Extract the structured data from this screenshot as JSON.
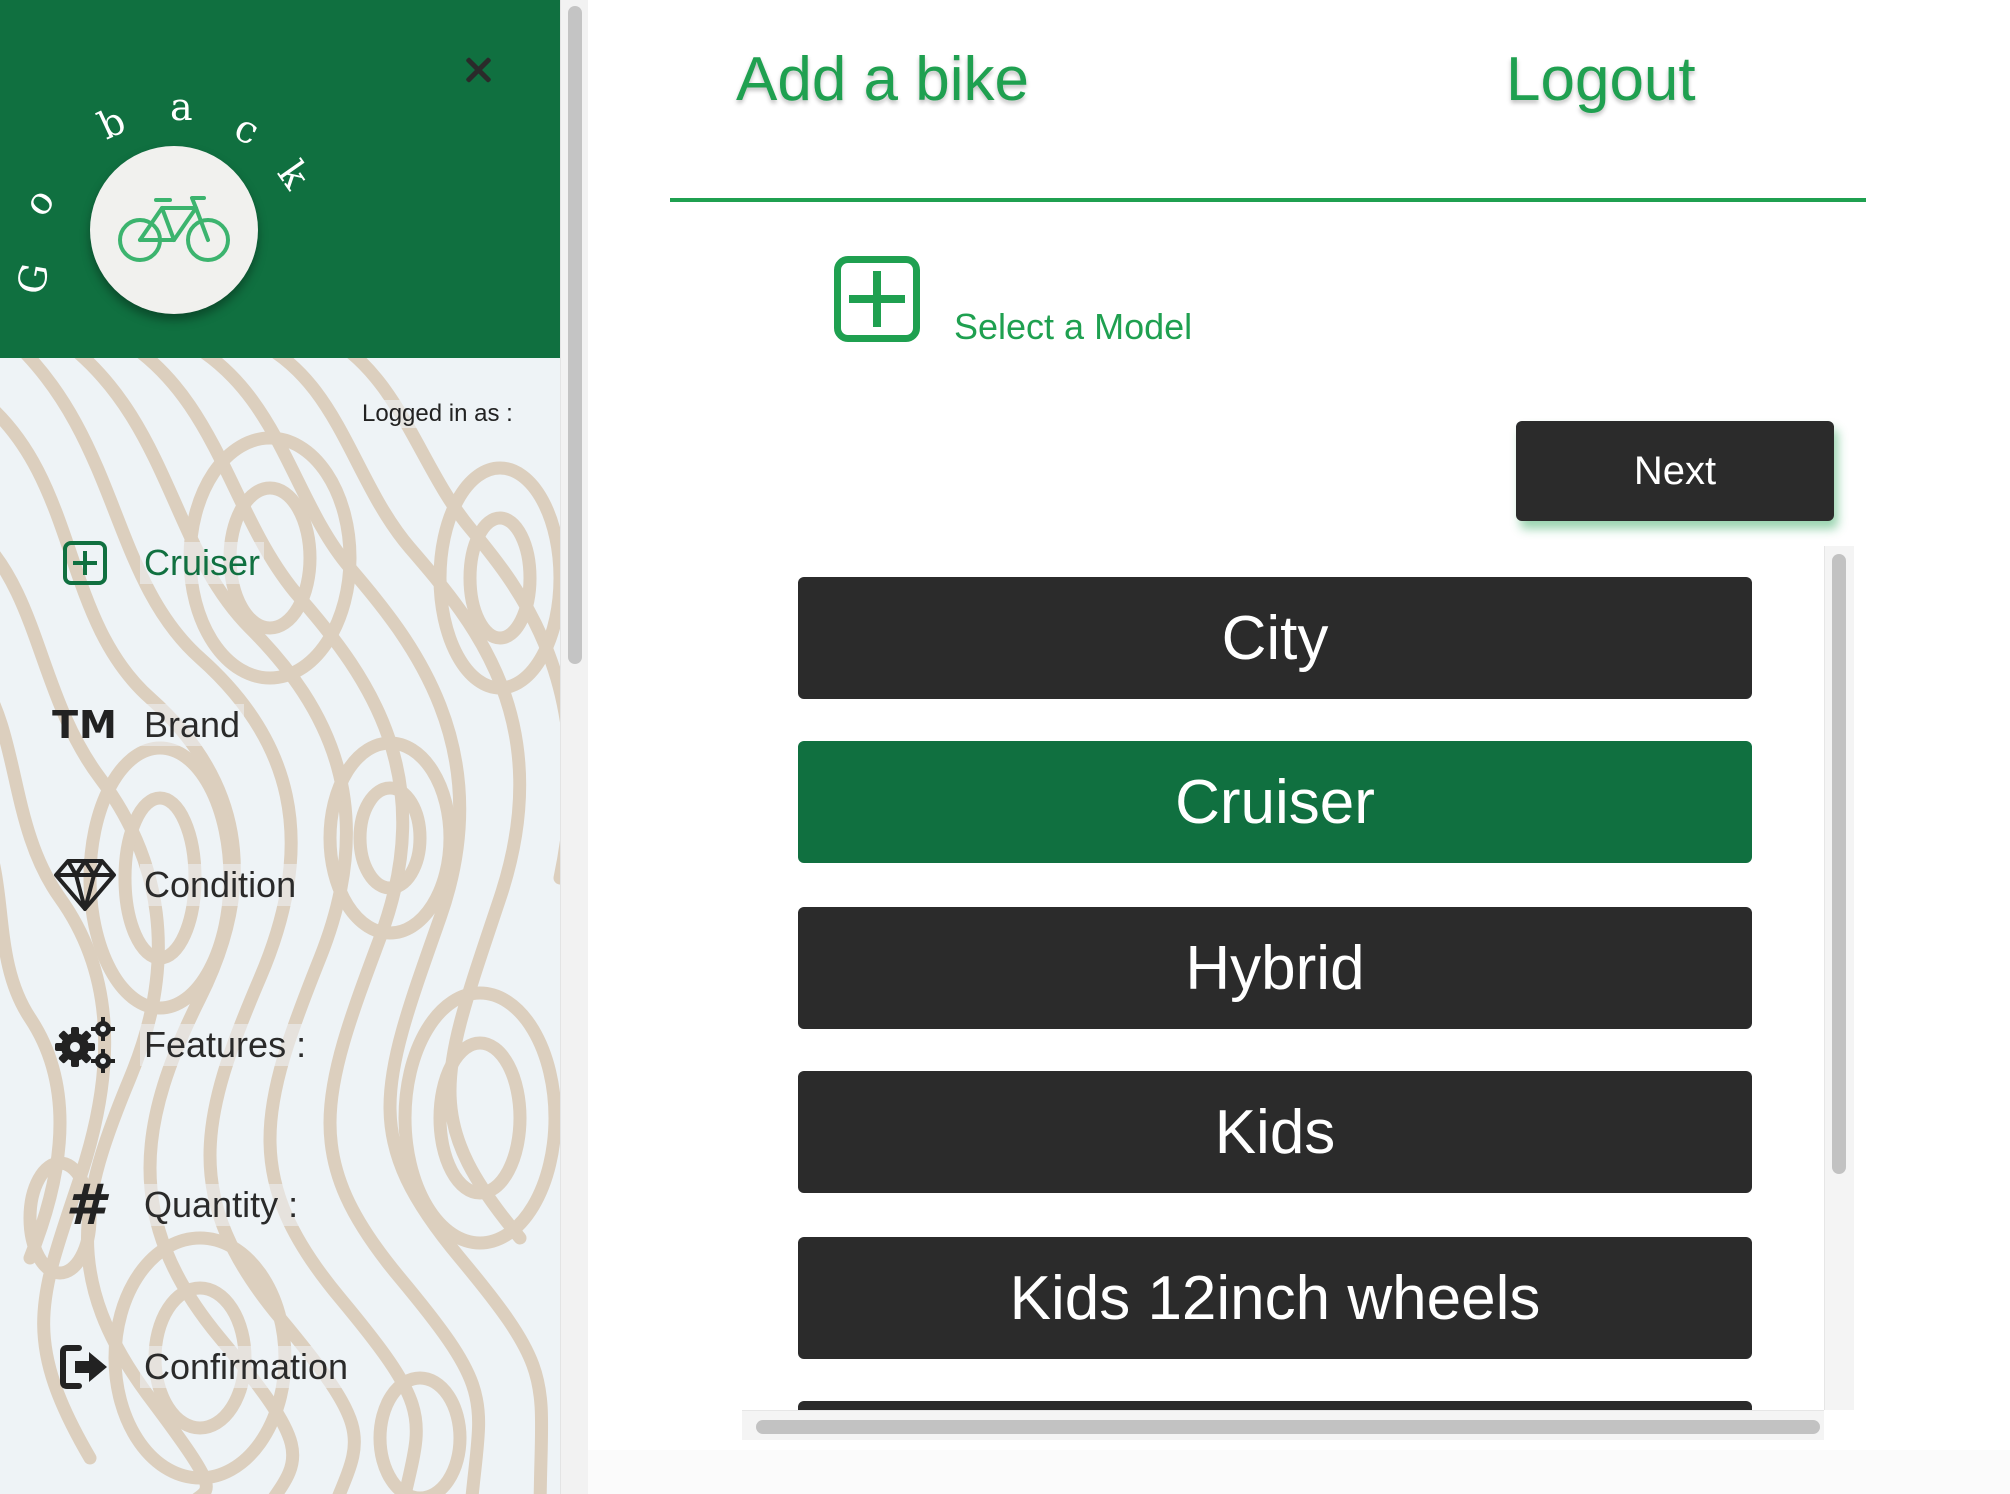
{
  "sidebar": {
    "logo_arc_text": [
      "G",
      "o",
      "b",
      "a",
      "c",
      "k"
    ],
    "logo_icon": "bicycle-icon",
    "close_icon": "close-icon",
    "logged_in_label": "Logged in as :",
    "items": [
      {
        "label": "Cruiser",
        "icon": "plus-square-icon",
        "active": true
      },
      {
        "label": "Brand",
        "icon": "trademark-icon",
        "icon_text": "TM"
      },
      {
        "label": "Condition",
        "icon": "diamond-icon"
      },
      {
        "label": "Features :",
        "icon": "gears-icon"
      },
      {
        "label": "Quantity :",
        "icon": "hashtag-icon",
        "icon_text": "#"
      },
      {
        "label": "Confirmation",
        "icon": "sign-out-icon"
      }
    ]
  },
  "header": {
    "add_bike": "Add a bike",
    "logout": "Logout"
  },
  "main": {
    "select_model_label": "Select a Model",
    "next_label": "Next",
    "models": [
      {
        "label": "City",
        "selected": false
      },
      {
        "label": "Cruiser",
        "selected": true
      },
      {
        "label": "Hybrid",
        "selected": false
      },
      {
        "label": "Kids",
        "selected": false
      },
      {
        "label": "Kids 12inch wheels",
        "selected": false
      }
    ]
  },
  "colors": {
    "brand_dark_green": "#107040",
    "accent_green": "#1fa050",
    "button_dark": "#2b2b2b",
    "pattern_beige": "#dccfbe",
    "sidebar_bg": "#eef3f6"
  }
}
